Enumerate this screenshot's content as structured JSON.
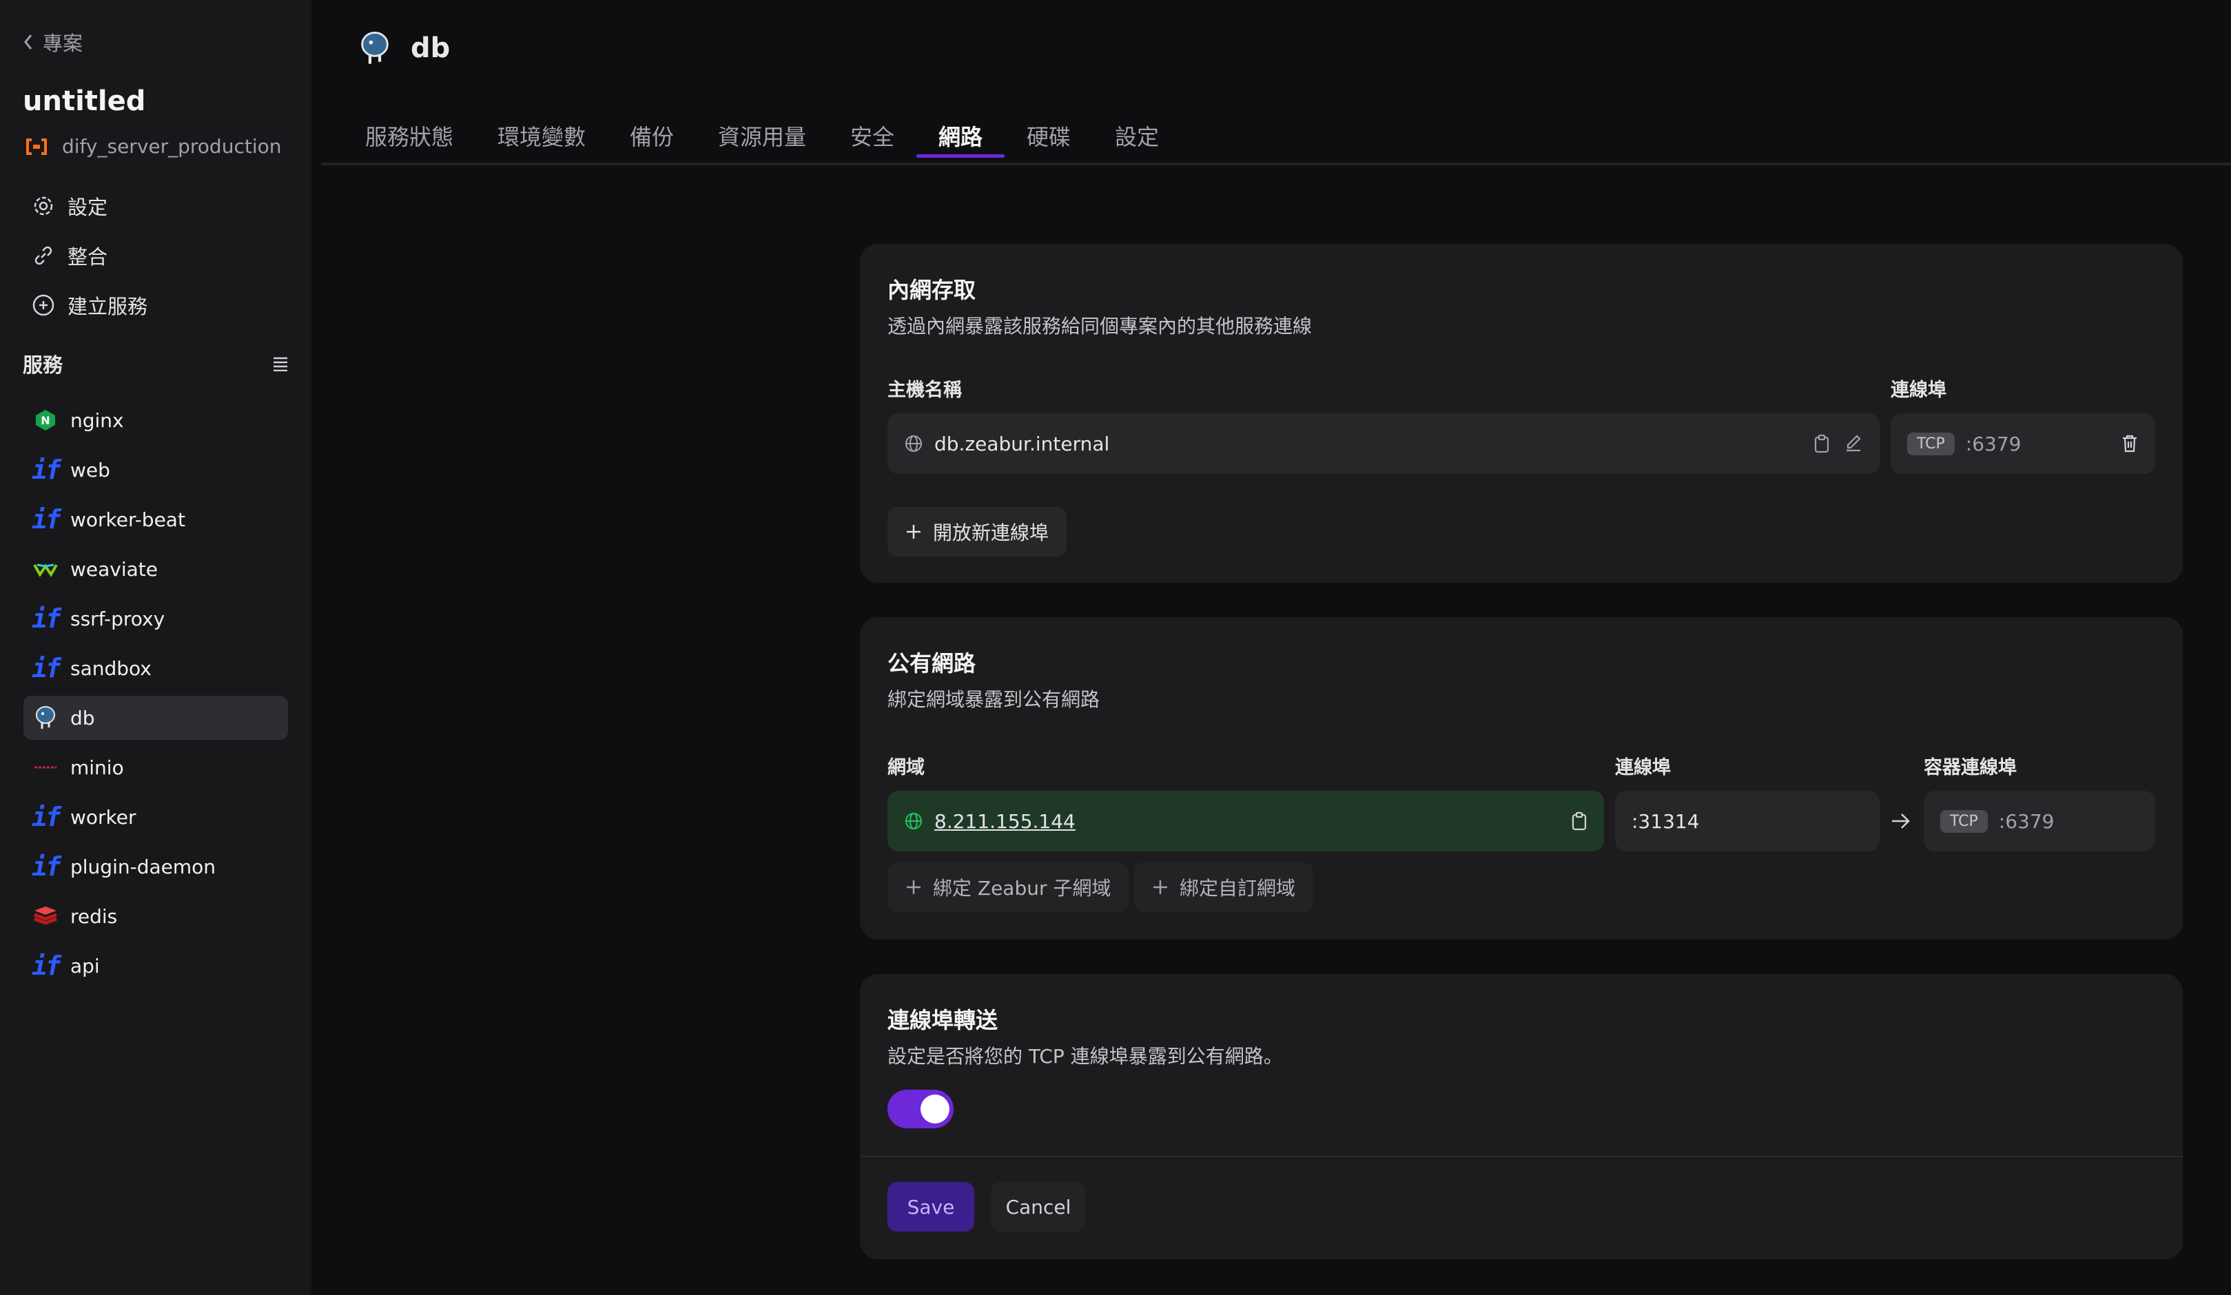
{
  "sidebar": {
    "back_label": "專案",
    "project_name": "untitled",
    "environment": "dify_server_production",
    "nav": [
      {
        "label": "設定",
        "icon": "gear-icon"
      },
      {
        "label": "整合",
        "icon": "link-icon"
      },
      {
        "label": "建立服務",
        "icon": "plus-circle-icon"
      }
    ],
    "services_header": "服務",
    "services": [
      {
        "name": "nginx",
        "icon": "nginx-icon"
      },
      {
        "name": "web",
        "icon": "dify-icon"
      },
      {
        "name": "worker-beat",
        "icon": "dify-icon"
      },
      {
        "name": "weaviate",
        "icon": "weaviate-icon"
      },
      {
        "name": "ssrf-proxy",
        "icon": "dify-icon"
      },
      {
        "name": "sandbox",
        "icon": "dify-icon"
      },
      {
        "name": "db",
        "icon": "postgres-icon",
        "active": true
      },
      {
        "name": "minio",
        "icon": "minio-icon"
      },
      {
        "name": "worker",
        "icon": "dify-icon"
      },
      {
        "name": "plugin-daemon",
        "icon": "dify-icon"
      },
      {
        "name": "redis",
        "icon": "redis-icon"
      },
      {
        "name": "api",
        "icon": "dify-icon"
      }
    ]
  },
  "header": {
    "service_name": "db",
    "tabs": [
      "服務狀態",
      "環境變數",
      "備份",
      "資源用量",
      "安全",
      "網路",
      "硬碟",
      "設定"
    ],
    "active_tab": "網路"
  },
  "private_network": {
    "title": "內網存取",
    "description": "透過內網暴露該服務給同個專案內的其他服務連線",
    "hostname_label": "主機名稱",
    "port_label": "連線埠",
    "hostname": "db.zeabur.internal",
    "protocol": "TCP",
    "port": ":6379",
    "add_port_label": "開放新連線埠"
  },
  "public_network": {
    "title": "公有網路",
    "description": "綁定網域暴露到公有網路",
    "domain_label": "網域",
    "port_label": "連線埠",
    "container_port_label": "容器連線埠",
    "domain": "8.211.155.144",
    "public_port": ":31314",
    "container_protocol": "TCP",
    "container_port": ":6379",
    "bind_zeabur_label": "綁定 Zeabur 子網域",
    "bind_custom_label": "綁定自訂網域"
  },
  "port_forwarding": {
    "title": "連線埠轉送",
    "description": "設定是否將您的 TCP 連線埠暴露到公有網路。",
    "enabled": true,
    "save_label": "Save",
    "cancel_label": "Cancel"
  },
  "colors": {
    "accent": "#6d28d9",
    "dify_blue": "#2c5cff",
    "domain_bg": "#1e3a27"
  }
}
